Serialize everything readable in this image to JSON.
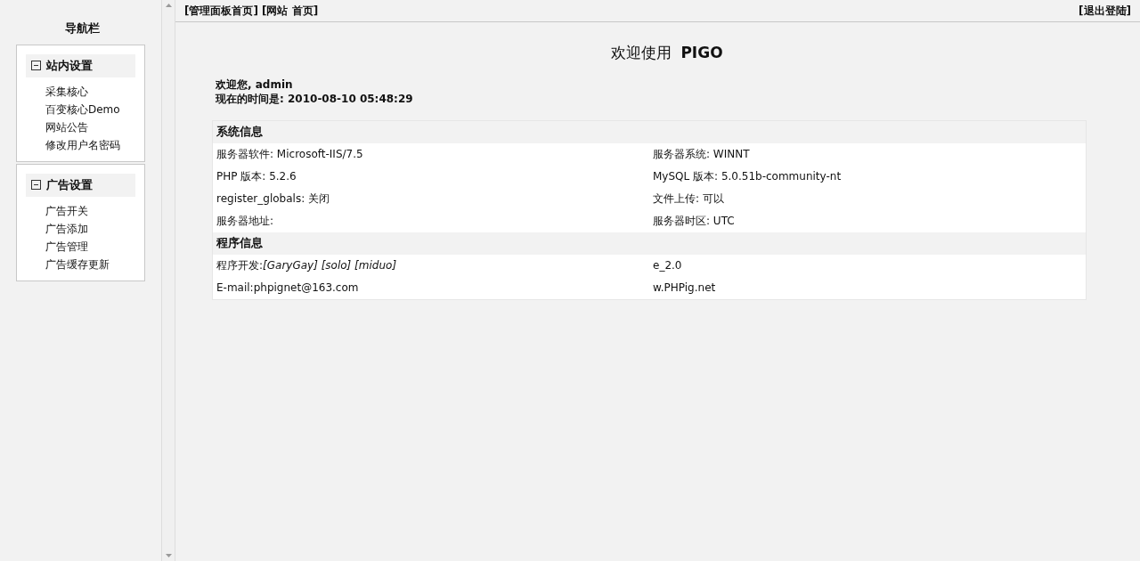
{
  "sidebar": {
    "title": "导航栏",
    "groups": [
      {
        "title": "站内设置",
        "expanded": true,
        "items": [
          "采集核心",
          "百变核心Demo",
          "网站公告",
          "修改用户名密码"
        ]
      },
      {
        "title": "广告设置",
        "expanded": true,
        "items": [
          "广告开关",
          "广告添加",
          "广告管理",
          "广告缓存更新"
        ]
      }
    ]
  },
  "top_links": [
    "[管理面板首页]",
    "[网站 首页]"
  ],
  "logout": "[退出登陆]",
  "heading": {
    "prefix": "欢迎使用",
    "name": "PIGO"
  },
  "welcome": [
    "欢迎您, admin",
    "现在的时间是: 2010-08-10 05:48:29"
  ],
  "sections": [
    {
      "title": "系统信息",
      "rows": [
        [
          "服务器软件: Microsoft-IIS/7.5",
          "服务器系统: WINNT"
        ],
        [
          "PHP 版本: 5.2.6",
          "MySQL 版本: 5.0.51b-community-nt"
        ],
        [
          "register_globals: 关闭",
          "文件上传: 可以"
        ],
        [
          "服务器地址:",
          "服务器时区: UTC"
        ]
      ]
    },
    {
      "title": "程序信息",
      "rows": [
        [
          "程序开发:*[GaryGay] [solo] [miduo]*",
          "e_2.0"
        ],
        [
          "E-mail:phpignet@163.com",
          "w.PHPig.net"
        ]
      ]
    }
  ]
}
